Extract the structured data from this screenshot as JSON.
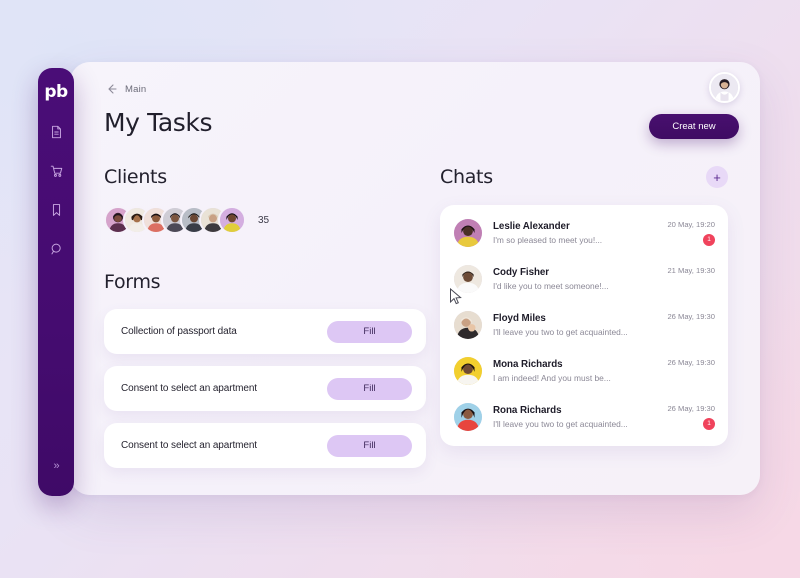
{
  "theme": {
    "brand_purple": "#48106f",
    "accent_lilac": "#ddc7f4",
    "badge_red": "#f0435c",
    "card_white": "#ffffff"
  },
  "sidebar": {
    "logo_text": "pb",
    "items": [
      {
        "name": "document-icon",
        "label": "Documents"
      },
      {
        "name": "cart-icon",
        "label": "Orders"
      },
      {
        "name": "bookmark-icon",
        "label": "Saved"
      },
      {
        "name": "search-icon",
        "label": "Search"
      }
    ],
    "expand_label": "»"
  },
  "topbar": {
    "breadcrumb_label": "Main",
    "back_icon": "arrow-left-icon",
    "avatar_alt": "User avatar"
  },
  "header": {
    "title": "My Tasks",
    "create_button_label": "Creat new"
  },
  "clients": {
    "title": "Clients",
    "count": "35",
    "avatars": [
      {
        "alt": "Client 1",
        "c1": "#d9a6cd",
        "c2": "#6f3b63"
      },
      {
        "alt": "Client 2",
        "c1": "#efe6dc",
        "c2": "#b08a62"
      },
      {
        "alt": "Client 3",
        "c1": "#f2ded6",
        "c2": "#d4706a"
      },
      {
        "alt": "Client 4",
        "c1": "#cfcfd6",
        "c2": "#4d4a55"
      },
      {
        "alt": "Client 5",
        "c1": "#b9bec6",
        "c2": "#3a3f48"
      },
      {
        "alt": "Client 6",
        "c1": "#e9e2d8",
        "c2": "#a08f7c"
      },
      {
        "alt": "Client 7",
        "c1": "#d8b6e0",
        "c2": "#e3cf3f"
      }
    ]
  },
  "forms": {
    "title": "Forms",
    "items": [
      {
        "label": "Collection of passport data",
        "action_label": "Fill"
      },
      {
        "label": "Consent to select an apartment",
        "action_label": "Fill"
      },
      {
        "label": "Consent to select an apartment",
        "action_label": "Fill"
      }
    ]
  },
  "chats": {
    "title": "Chats",
    "add_label": "+",
    "items": [
      {
        "name": "Leslie Alexander",
        "preview": "I'm so pleased to meet you!...",
        "time": "20 May, 19:20",
        "badge": "1",
        "av1": "#c07fb4",
        "av2": "#e8c93d"
      },
      {
        "name": "Cody Fisher",
        "preview": "I'd like you to meet someone!...",
        "time": "21 May, 19:30",
        "badge": "",
        "av1": "#ece6de",
        "av2": "#6d5242"
      },
      {
        "name": "Floyd Miles",
        "preview": "I'll leave you two to get acquainted...",
        "time": "26 May, 19:30",
        "badge": "",
        "av1": "#e7ddd0",
        "av2": "#8d6f55"
      },
      {
        "name": "Mona Richards",
        "preview": "I am indeed! And you must be...",
        "time": "26 May, 19:30",
        "badge": "",
        "av1": "#f2cf2e",
        "av2": "#caa21f"
      },
      {
        "name": "Rona Richards",
        "preview": "I'll leave you two to get acquainted...",
        "time": "26 May, 19:30",
        "badge": "1",
        "av1": "#e8453d",
        "av2": "#9fd1e8"
      }
    ]
  }
}
